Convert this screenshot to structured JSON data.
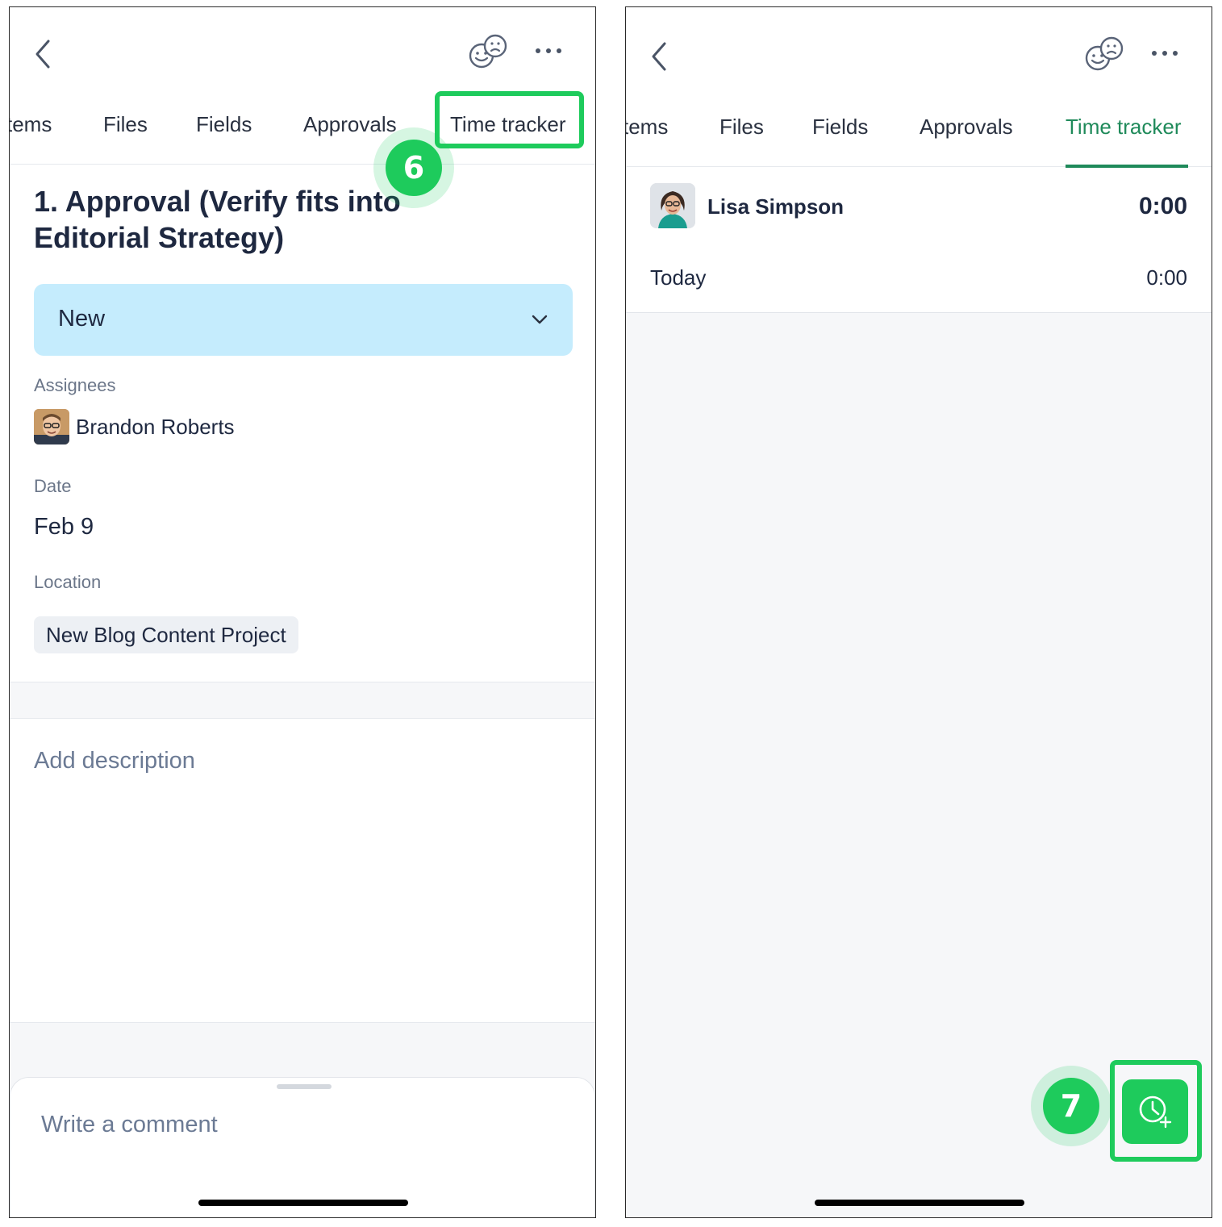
{
  "left_screen": {
    "tabs": [
      {
        "label": "tems"
      },
      {
        "label": "Files"
      },
      {
        "label": "Fields"
      },
      {
        "label": "Approvals"
      },
      {
        "label": "Time tracker"
      }
    ],
    "step_badge": "6",
    "task_title": "1. Approval (Verify fits into Editorial Strategy)",
    "status": "New",
    "assignees_label": "Assignees",
    "assignee_name": "Brandon Roberts",
    "date_label": "Date",
    "date_value": "Feb 9",
    "location_label": "Location",
    "location_value": "New Blog Content Project",
    "description_placeholder": "Add description",
    "comment_placeholder": "Write a comment"
  },
  "right_screen": {
    "tabs": [
      {
        "label": "tems"
      },
      {
        "label": "Files"
      },
      {
        "label": "Fields"
      },
      {
        "label": "Approvals"
      },
      {
        "label": "Time tracker",
        "active": true
      }
    ],
    "user_name": "Lisa Simpson",
    "user_total": "0:00",
    "today_label": "Today",
    "today_value": "0:00",
    "step_badge": "7"
  },
  "icons": {
    "back": "chevron-left-icon",
    "reactions": "faces-icon",
    "more": "more-dots-icon",
    "status_dropdown": "chevron-down-icon",
    "add_time": "clock-plus-icon"
  },
  "colors": {
    "accent_green": "#1ecb5c",
    "active_tab": "#1f8a5a",
    "status_bg": "#c5ecfd",
    "text_dark": "#1e2840",
    "muted": "#6b7689"
  }
}
